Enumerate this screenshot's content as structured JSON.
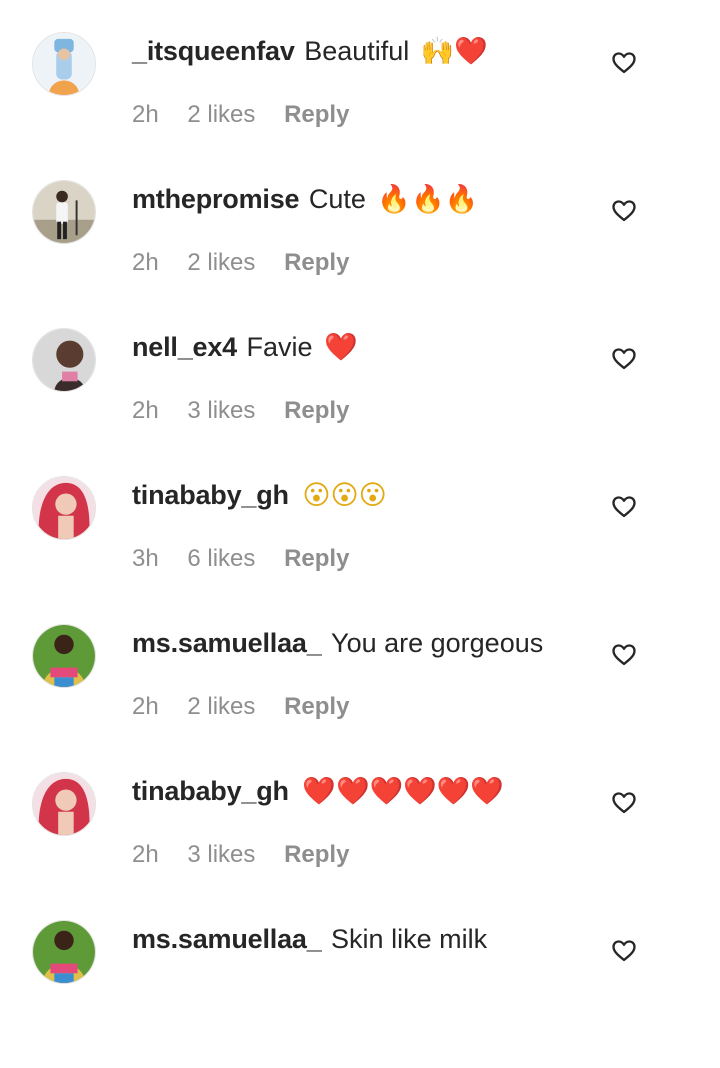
{
  "comments": [
    {
      "username": "_itsqueenfav",
      "text": "Beautiful",
      "emoji": "🙌❤️",
      "time": "2h",
      "likes": "2 likes",
      "reply": "Reply",
      "avatar_color": "#c9dff2"
    },
    {
      "username": "mthepromise",
      "text": "Cute",
      "emoji": "🔥🔥🔥",
      "time": "2h",
      "likes": "2 likes",
      "reply": "Reply",
      "avatar_color": "#b8b3a4"
    },
    {
      "username": "nell_ex4",
      "text": "Favie",
      "emoji": "❤️",
      "time": "2h",
      "likes": "3 likes",
      "reply": "Reply",
      "avatar_color": "#6e5245"
    },
    {
      "username": "tinababy_gh",
      "text": "",
      "emoji": "😮😮😮",
      "time": "3h",
      "likes": "6 likes",
      "reply": "Reply",
      "avatar_color": "#d2344a"
    },
    {
      "username": "ms.samuellaa_",
      "text": "You are gorgeous",
      "emoji": "",
      "time": "2h",
      "likes": "2 likes",
      "reply": "Reply",
      "avatar_color": "#4c8a2e"
    },
    {
      "username": "tinababy_gh",
      "text": "",
      "emoji": "❤️❤️❤️❤️❤️❤️",
      "time": "2h",
      "likes": "3 likes",
      "reply": "Reply",
      "avatar_color": "#d2344a"
    },
    {
      "username": "ms.samuellaa_",
      "text": "Skin like milk",
      "emoji": "",
      "time": "",
      "likes": "",
      "reply": "",
      "avatar_color": "#4c8a2e"
    }
  ],
  "icons": {
    "like": "heart-outline-icon"
  },
  "colors": {
    "text": "#262626",
    "meta": "#8e8e8e"
  }
}
